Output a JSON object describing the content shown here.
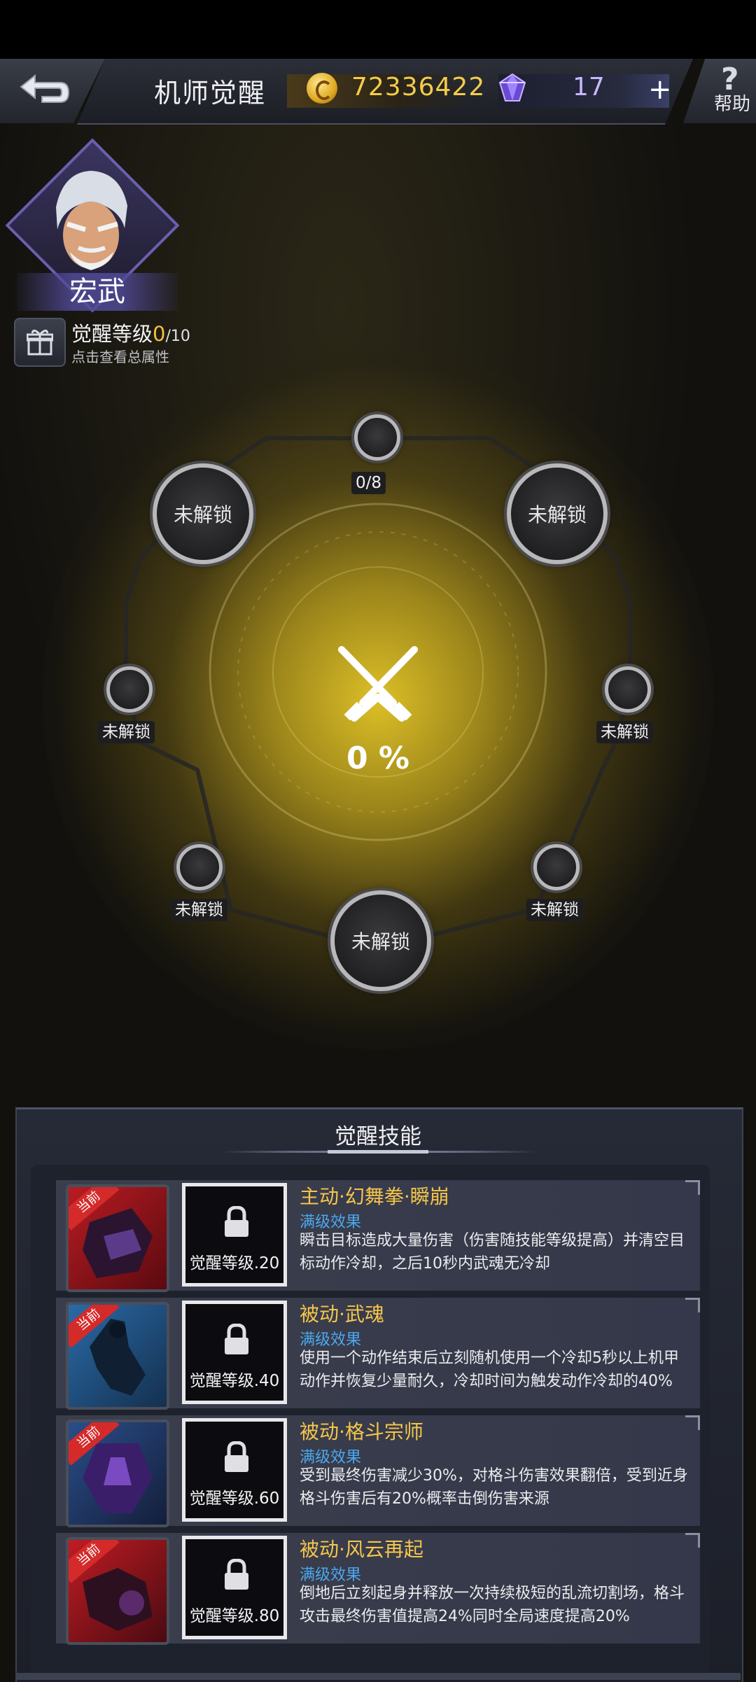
{
  "header": {
    "title": "机师觉醒",
    "gold": "72336422",
    "gems": "17",
    "plus": "+",
    "help_symbol": "?",
    "help_label": "帮助"
  },
  "character": {
    "name": "宏武",
    "awaken_label": "觉醒等级",
    "awaken_current": "0",
    "awaken_max": "/10",
    "awaken_hint": "点击查看总属性"
  },
  "wheel": {
    "top_progress": "0/8",
    "center_percent": "0 %",
    "locked_label": "未解锁"
  },
  "skills_panel": {
    "title": "觉醒技能",
    "current_tag": "当前",
    "effect_label": "满级效果",
    "skills": [
      {
        "name": "主动·幻舞拳·瞬崩",
        "lock_label": "觉醒等级.20",
        "desc": "瞬击目标造成大量伤害（伤害随技能等级提高）并清空目标动作冷却，之后10秒内武魂无冷却"
      },
      {
        "name": "被动·武魂",
        "lock_label": "觉醒等级.40",
        "desc": "使用一个动作结束后立刻随机使用一个冷却5秒以上机甲动作并恢复少量耐久，冷却时间为触发动作冷却的40%"
      },
      {
        "name": "被动·格斗宗师",
        "lock_label": "觉醒等级.60",
        "desc": "受到最终伤害减少30%，对格斗伤害效果翻倍，受到近身格斗伤害后有20%概率击倒伤害来源"
      },
      {
        "name": "被动·风云再起",
        "lock_label": "觉醒等级.80",
        "desc": "倒地后立刻起身并释放一次持续极短的乱流切割场，格斗攻击最终伤害值提高24%同时全局速度提高20%"
      }
    ]
  },
  "colors": {
    "gold_text": "#f4cc4c",
    "skill_name": "#f6c64a",
    "effect_blue": "#4ca8ee",
    "glow_yellow": "#e6c828",
    "ribbon_red": "#d42a2a"
  }
}
